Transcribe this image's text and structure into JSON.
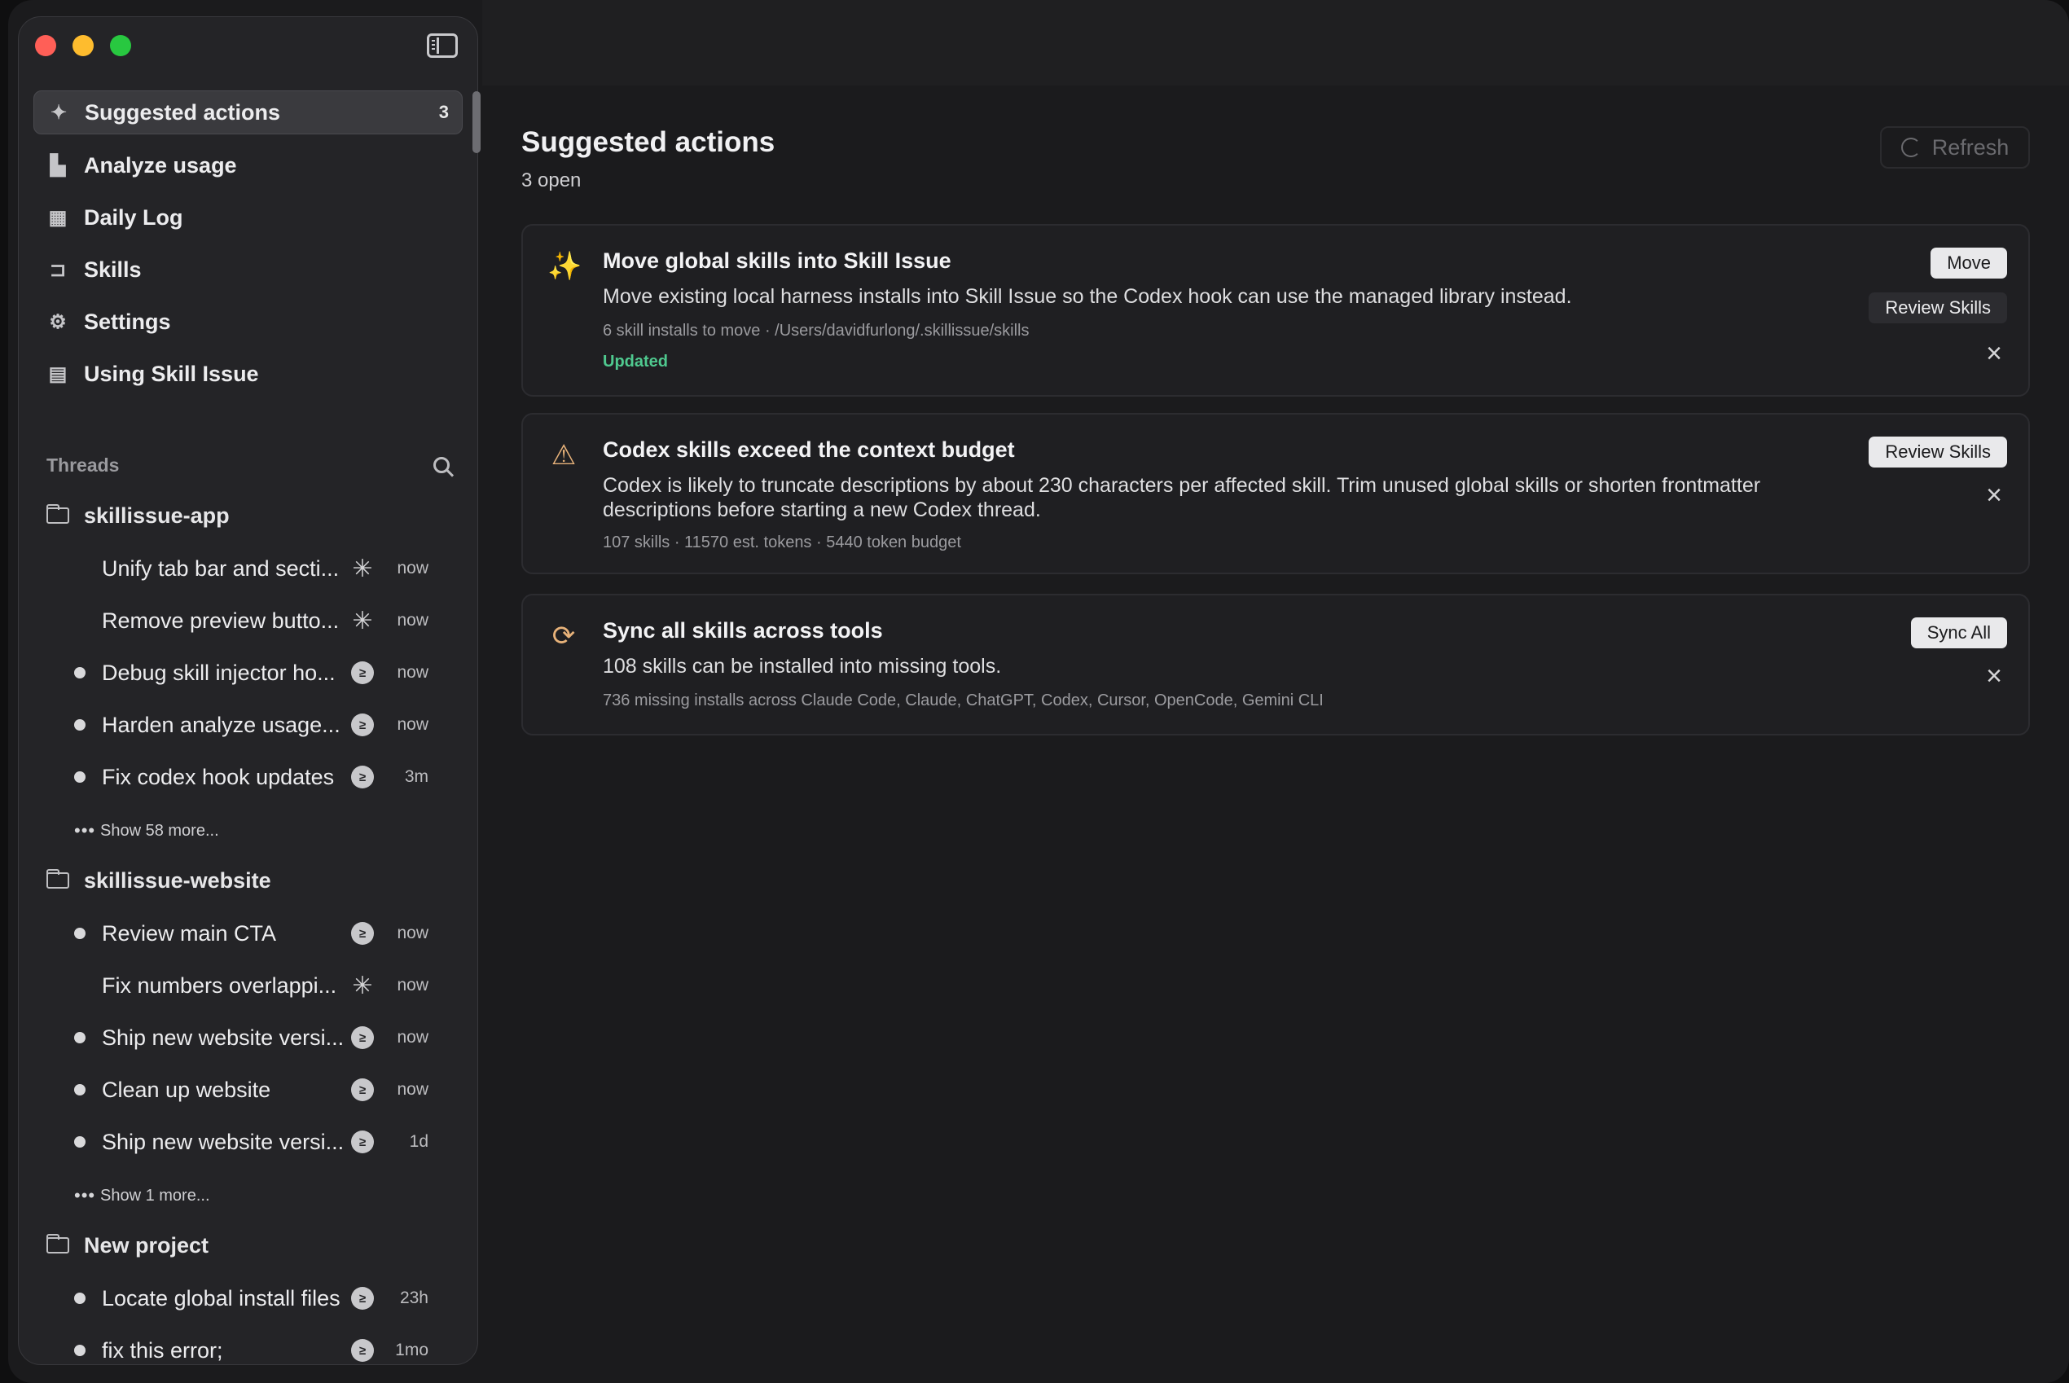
{
  "sidebar": {
    "nav": [
      {
        "label": "Suggested actions",
        "icon": "sparkle-icon",
        "badge": "3",
        "active": true
      },
      {
        "label": "Analyze usage",
        "icon": "bar-chart-icon"
      },
      {
        "label": "Daily Log",
        "icon": "calendar-icon"
      },
      {
        "label": "Skills",
        "icon": "skills-icon"
      },
      {
        "label": "Settings",
        "icon": "gear-icon"
      },
      {
        "label": "Using Skill Issue",
        "icon": "book-icon"
      }
    ],
    "threads_title": "Threads",
    "projects": [
      {
        "name": "skillissue-app",
        "threads": [
          {
            "label": "Unify tab bar and secti...",
            "agent": "spark",
            "time": "now",
            "unread": false
          },
          {
            "label": "Remove preview butto...",
            "agent": "spark",
            "time": "now",
            "unread": false
          },
          {
            "label": "Debug skill injector ho...",
            "agent": "bot",
            "time": "now",
            "unread": true
          },
          {
            "label": "Harden analyze usage...",
            "agent": "bot",
            "time": "now",
            "unread": true
          },
          {
            "label": "Fix codex hook updates",
            "agent": "bot",
            "time": "3m",
            "unread": true
          }
        ],
        "show_more": "Show 58 more..."
      },
      {
        "name": "skillissue-website",
        "threads": [
          {
            "label": "Review main CTA",
            "agent": "bot",
            "time": "now",
            "unread": true
          },
          {
            "label": "Fix numbers overlappi...",
            "agent": "spark",
            "time": "now",
            "unread": false
          },
          {
            "label": "Ship new website versi...",
            "agent": "bot",
            "time": "now",
            "unread": true
          },
          {
            "label": "Clean up website",
            "agent": "bot",
            "time": "now",
            "unread": true
          },
          {
            "label": "Ship new website versi...",
            "agent": "bot",
            "time": "1d",
            "unread": true
          }
        ],
        "show_more": "Show 1 more..."
      },
      {
        "name": "New project",
        "threads": [
          {
            "label": "Locate global install files",
            "agent": "bot",
            "time": "23h",
            "unread": true
          },
          {
            "label": "fix this error;",
            "agent": "bot",
            "time": "1mo",
            "unread": true
          }
        ]
      }
    ]
  },
  "main": {
    "title": "Suggested actions",
    "subtitle": "3 open",
    "refresh_label": "Refresh",
    "cards": [
      {
        "icon": "wand-icon",
        "title": "Move global skills into Skill Issue",
        "description": "Move existing local harness installs into Skill Issue so the Codex hook can use the managed library instead.",
        "meta": "6 skill installs to move · /Users/davidfurlong/.skillissue/skills",
        "status": "Updated",
        "primary_button": "Move",
        "secondary_button": "Review Skills"
      },
      {
        "icon": "warning-icon",
        "title": "Codex skills exceed the context budget",
        "description": "Codex is likely to truncate descriptions by about 230 characters per affected skill. Trim unused global skills or shorten frontmatter descriptions before starting a new Codex thread.",
        "meta": "107 skills · 11570 est. tokens · 5440 token budget",
        "primary_button": "Review Skills"
      },
      {
        "icon": "sync-icon",
        "title": "Sync all skills across tools",
        "description": "108 skills can be installed into missing tools.",
        "meta": "736 missing installs across Claude Code, Claude, ChatGPT, Codex, Cursor, OpenCode, Gemini CLI",
        "primary_button": "Sync All"
      }
    ]
  },
  "colors": {
    "accent_status": "#4fc98f",
    "icon_accent": "#e7b27a",
    "traffic_red": "#ff5f57",
    "traffic_yellow": "#febc2e",
    "traffic_green": "#28c840"
  }
}
